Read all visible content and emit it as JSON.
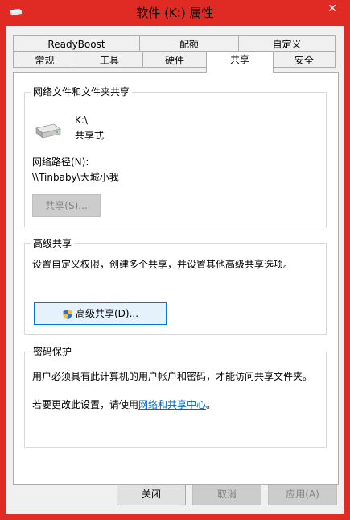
{
  "window": {
    "title": "软件 (K:) 属性",
    "close_label": "✕"
  },
  "tabs_row1": [
    {
      "label": "ReadyBoost"
    },
    {
      "label": "配额"
    },
    {
      "label": "自定义"
    }
  ],
  "tabs_row2": [
    {
      "label": "常规"
    },
    {
      "label": "工具"
    },
    {
      "label": "硬件"
    },
    {
      "label": "共享"
    },
    {
      "label": "安全"
    }
  ],
  "network_sharing": {
    "title": "网络文件和文件夹共享",
    "drive_name": "K:\\",
    "drive_status": "共享式",
    "path_label": "网络路径(N):",
    "path_value": "\\\\Tinbaby\\大城小我",
    "share_button": "共享(S)..."
  },
  "advanced_sharing": {
    "title": "高级共享",
    "description": "设置自定义权限，创建多个共享，并设置其他高级共享选项。",
    "button": "高级共享(D)..."
  },
  "password_protection": {
    "title": "密码保护",
    "description": "用户必须具有此计算机的用户帐户和密码，才能访问共享文件夹。",
    "change_prefix": "若要更改此设置，请使用",
    "change_link": "网络和共享中心",
    "change_suffix": "。"
  },
  "footer": {
    "close": "关闭",
    "cancel": "取消",
    "apply": "应用(A)"
  }
}
